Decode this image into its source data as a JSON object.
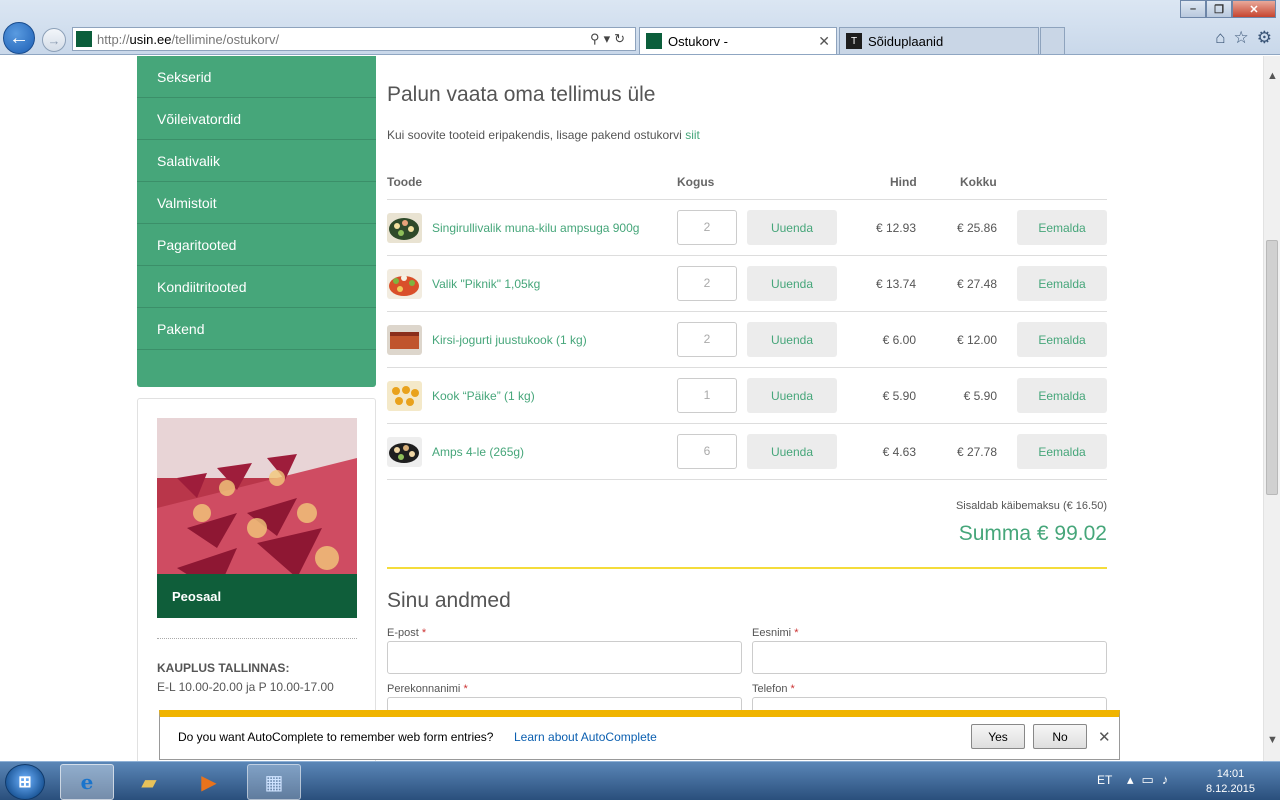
{
  "browser": {
    "url_prefix": "http://",
    "url_domain": "usin.ee",
    "url_path": "/tellimine/ostukorv/",
    "tabs": [
      {
        "label": "Ostukorv -"
      },
      {
        "label": "Sõiduplaanid"
      }
    ]
  },
  "sidebar": {
    "items": [
      {
        "label": "Sekserid"
      },
      {
        "label": "Võileivatordid"
      },
      {
        "label": "Salativalik"
      },
      {
        "label": "Valmistoit"
      },
      {
        "label": "Pagaritooted"
      },
      {
        "label": "Kondiitritooted"
      },
      {
        "label": "Pakend"
      }
    ]
  },
  "promo": {
    "caption": "Peosaal",
    "shop_title": "KAUPLUS TALLINNAS:",
    "shop_hours": "E-L 10.00-20.00 ja P 10.00-17.00"
  },
  "cart": {
    "title": "Palun vaata oma tellimus üle",
    "note": "Kui soovite tooteid eripakendis, lisage pakend ostukorvi ",
    "note_link": "siit",
    "headers": {
      "product": "Toode",
      "qty": "Kogus",
      "price": "Hind",
      "total": "Kokku"
    },
    "update_label": "Uuenda",
    "remove_label": "Eemalda",
    "rows": [
      {
        "name": "Singirullivalik muna-kilu ampsuga 900g",
        "qty": "2",
        "price": "€ 12.93",
        "total": "€ 25.86"
      },
      {
        "name": "Valik \"Piknik\" 1,05kg",
        "qty": "2",
        "price": "€ 13.74",
        "total": "€ 27.48"
      },
      {
        "name": "Kirsi-jogurti juustukook (1 kg)",
        "qty": "2",
        "price": "€ 6.00",
        "total": "€ 12.00"
      },
      {
        "name": "Kook “Päike” (1 kg)",
        "qty": "1",
        "price": "€ 5.90",
        "total": "€ 5.90"
      },
      {
        "name": "Amps 4-le (265g)",
        "qty": "6",
        "price": "€ 4.63",
        "total": "€ 27.78"
      }
    ],
    "vat_note": "Sisaldab käibemaksu (€ 16.50)",
    "sum": "Summa € 99.02"
  },
  "form": {
    "title": "Sinu andmed",
    "email_label": "E-post",
    "firstname_label": "Eesnimi",
    "lastname_label": "Perekonnanimi",
    "phone_label": "Telefon",
    "required_mark": "*"
  },
  "autocomplete": {
    "question": "Do you want AutoComplete to remember web form entries?",
    "link": "Learn about AutoComplete",
    "yes": "Yes",
    "no": "No"
  },
  "taskbar": {
    "lang": "ET",
    "time": "14:01",
    "date": "8.12.2015"
  },
  "colors": {
    "brand_green": "#46a67a",
    "dark_green": "#0f5e3a",
    "accent_yellow": "#f4dc3b"
  }
}
